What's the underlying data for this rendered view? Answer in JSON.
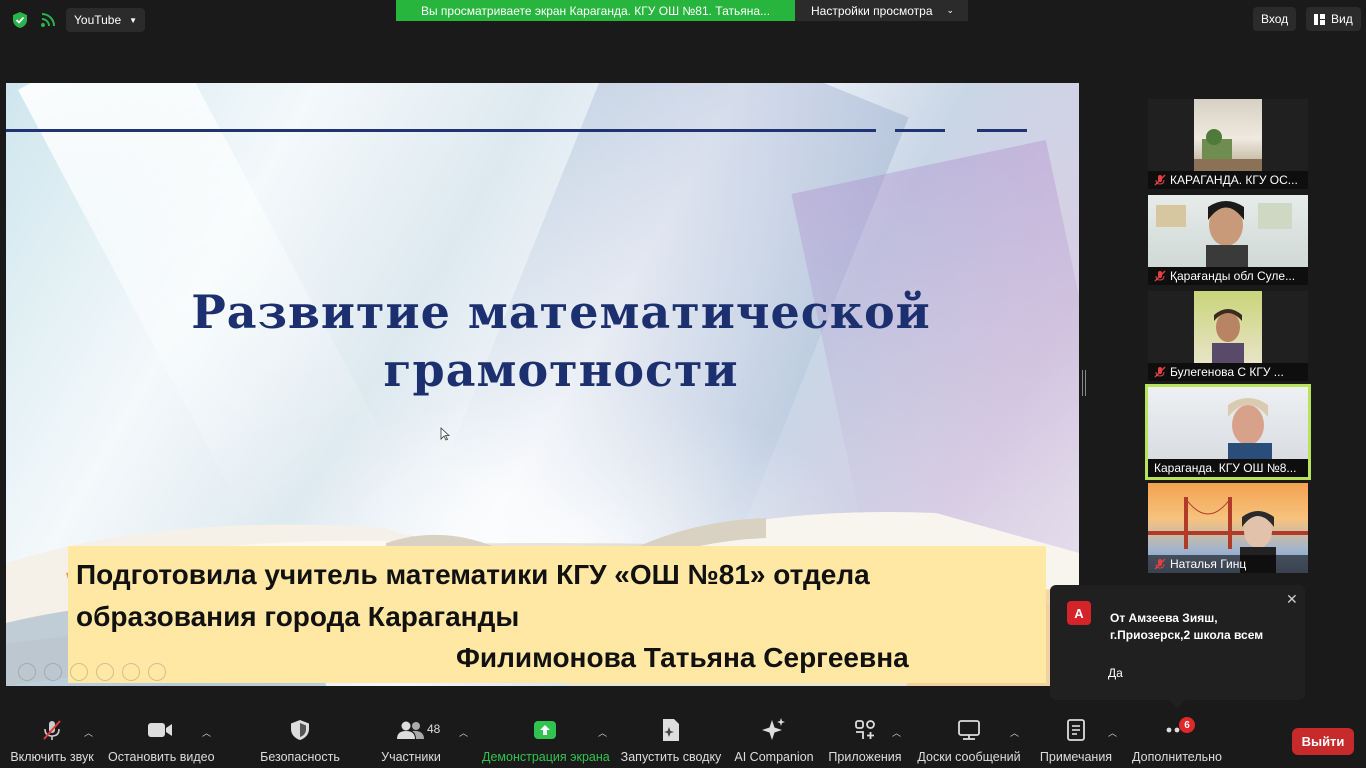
{
  "topbar": {
    "youtube_label": "YouTube",
    "share_banner": "Вы просматриваете экран Караганда. КГУ ОШ №81. Татьяна...",
    "view_settings_label": "Настройки просмотра",
    "enter_label": "Вход",
    "view_label": "Вид"
  },
  "slide": {
    "title_line1": "Развитие математической",
    "title_line2": "грамотности",
    "caption_line1": "Подготовила учитель математики КГУ «ОШ №81» отдела образования города Караганды",
    "caption_line2": "Филимонова Татьяна Сергеевна"
  },
  "participants": [
    {
      "name": "КАРАГАНДА. КГУ ОС..."
    },
    {
      "name": "Қарағанды обл Суле..."
    },
    {
      "name": "Булегенова С КГУ ..."
    },
    {
      "name": "Караганда. КГУ ОШ №8..."
    },
    {
      "name": "Наталья Гинц"
    }
  ],
  "chat_toast": {
    "avatar_letter": "А",
    "from": "От Амзеева Зияш, г.Приозерск,2 школа всем",
    "message": "Да"
  },
  "toolbar": {
    "audio": "Включить звук",
    "video": "Остановить видео",
    "security": "Безопасность",
    "participants": "Участники",
    "participants_count": "48",
    "share": "Демонстрация экрана",
    "summary": "Запустить сводку",
    "ai": "AI Companion",
    "apps": "Приложения",
    "whiteboards": "Доски сообщений",
    "notes": "Примечания",
    "more": "Дополнительно",
    "more_badge": "6",
    "leave": "Выйти"
  },
  "colors": {
    "banner_green": "#27b53d",
    "active_speaker_border": "#b8e35a",
    "leave_red": "#c62a2a",
    "slide_title": "#1c2f6e",
    "caption_bg": "#ffe7a4"
  }
}
